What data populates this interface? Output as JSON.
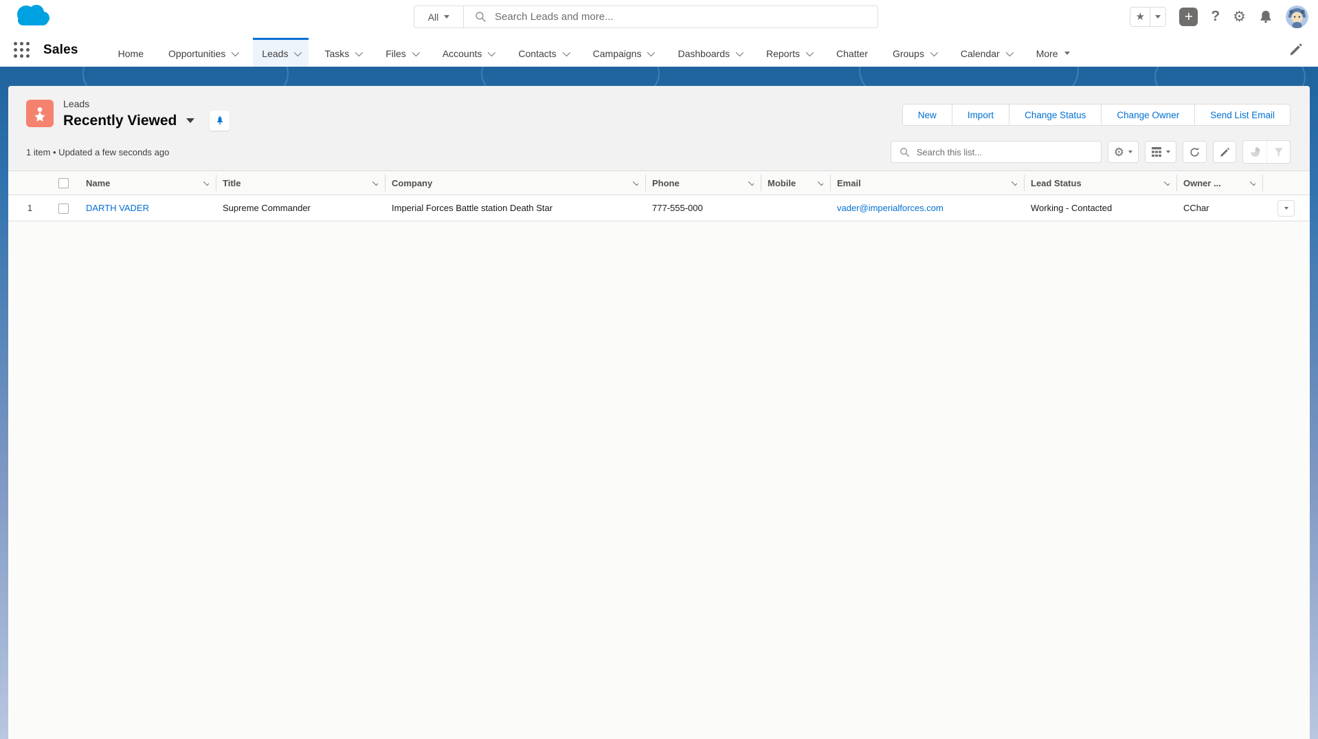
{
  "colors": {
    "brand_link_blue": "#0070d2",
    "band_blue": "#1f639e",
    "lead_icon_orange": "#F4826E",
    "page_header_gray": "#f3f2f2"
  },
  "global_header": {
    "logo_icon": "salesforce-cloud-icon",
    "search": {
      "scope_label": "All",
      "placeholder": "Search Leads and more..."
    },
    "action_icons": [
      "favorites-star-icon",
      "favorites-caret-icon",
      "global-actions-plus-icon",
      "help-icon",
      "setup-gear-icon",
      "notifications-bell-icon",
      "user-avatar"
    ]
  },
  "nav": {
    "app_name": "Sales",
    "tabs": [
      {
        "label": "Home",
        "has_menu": false,
        "active": false
      },
      {
        "label": "Opportunities",
        "has_menu": true,
        "active": false
      },
      {
        "label": "Leads",
        "has_menu": true,
        "active": true
      },
      {
        "label": "Tasks",
        "has_menu": true,
        "active": false
      },
      {
        "label": "Files",
        "has_menu": true,
        "active": false
      },
      {
        "label": "Accounts",
        "has_menu": true,
        "active": false
      },
      {
        "label": "Contacts",
        "has_menu": true,
        "active": false
      },
      {
        "label": "Campaigns",
        "has_menu": true,
        "active": false
      },
      {
        "label": "Dashboards",
        "has_menu": true,
        "active": false
      },
      {
        "label": "Reports",
        "has_menu": true,
        "active": false
      },
      {
        "label": "Chatter",
        "has_menu": false,
        "active": false
      },
      {
        "label": "Groups",
        "has_menu": true,
        "active": false
      },
      {
        "label": "Calendar",
        "has_menu": true,
        "active": false
      },
      {
        "label": "More",
        "has_menu": true,
        "active": false
      }
    ],
    "edit_icon": "pencil-icon"
  },
  "page_header": {
    "object_label": "Leads",
    "object_icon": "lead-person-star-icon",
    "list_view_title": "Recently Viewed",
    "pin_icon": "pin-icon",
    "buttons": [
      "New",
      "Import",
      "Change Status",
      "Change Owner",
      "Send List Email"
    ],
    "meta": "1 item • Updated a few seconds ago"
  },
  "list_controls": {
    "search_placeholder": "Search this list...",
    "icons": [
      "list-settings-gear-icon",
      "display-as-table-icon",
      "refresh-icon",
      "inline-edit-pencil-icon",
      "charts-pie-icon-disabled",
      "filter-funnel-icon-disabled"
    ]
  },
  "table": {
    "columns": [
      "Name",
      "Title",
      "Company",
      "Phone",
      "Mobile",
      "Email",
      "Lead Status",
      "Owner ..."
    ],
    "rows": [
      {
        "num": "1",
        "name": "DARTH VADER",
        "title": "Supreme Commander",
        "company": "Imperial Forces Battle station Death Star",
        "phone": "777-555-000",
        "mobile": "",
        "email": "vader@imperialforces.com",
        "lead_status": "Working - Contacted",
        "owner_alias": "CChar"
      }
    ]
  }
}
